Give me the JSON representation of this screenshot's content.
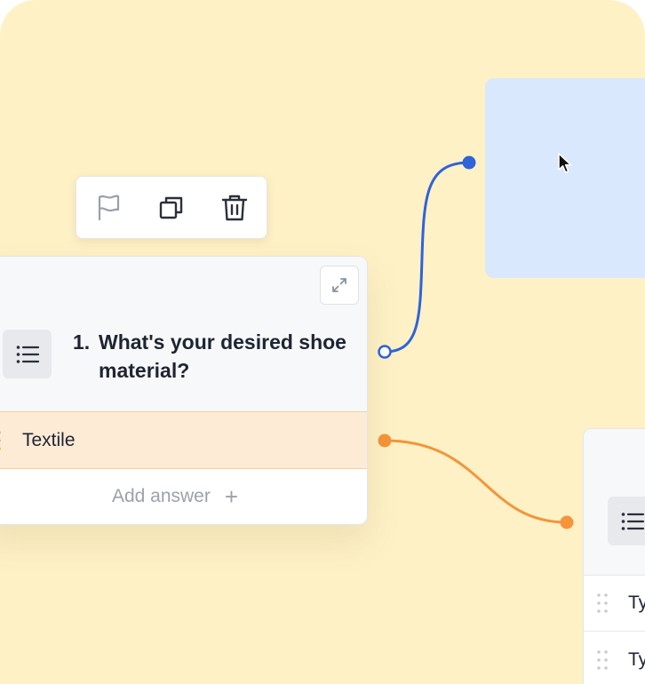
{
  "toolbar": {
    "items": [
      {
        "icon": "flag-icon",
        "color": "#9aa0aa"
      },
      {
        "icon": "copy-icon",
        "color": "#2b2f3a"
      },
      {
        "icon": "trash-icon",
        "color": "#2b2f3a"
      }
    ]
  },
  "question": {
    "number": "1.",
    "text": "What's your desired shoe material?",
    "icon": "list-icon",
    "expand_icon": "expand-icon"
  },
  "answers": [
    {
      "label": "Textile",
      "highlight_color": "#fdebd5"
    }
  ],
  "add_answer": {
    "label": "Add answer",
    "icon": "plus-icon"
  },
  "next_card": {
    "icon": "list-icon",
    "answers": [
      {
        "label": "Ty"
      },
      {
        "label": "Ty"
      }
    ]
  },
  "colors": {
    "canvas": "#fef1c6",
    "blue_connector": "#2f63d8",
    "orange_connector": "#f5943a",
    "blue_panel": "#d9e8fd"
  }
}
